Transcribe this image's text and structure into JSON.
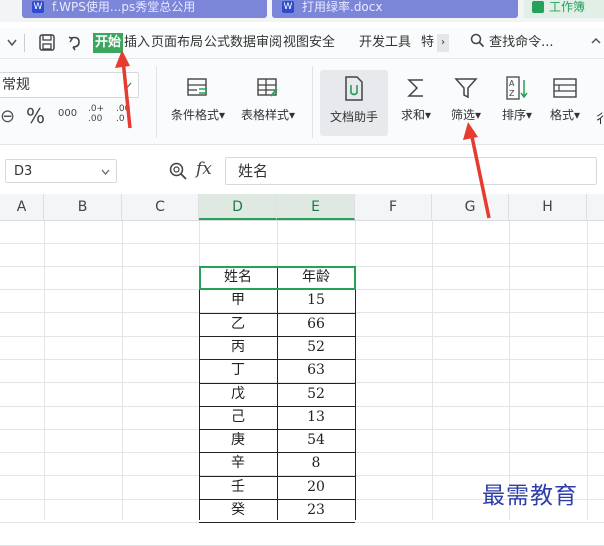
{
  "tabs": [
    {
      "label": "f.WPS使用...ps秀堂总公用"
    },
    {
      "label": "打用绿率.docx"
    },
    {
      "label": "工作簿"
    }
  ],
  "menubar": {
    "items": [
      "开始",
      "插入",
      "页面布局",
      "公式",
      "数据",
      "审阅",
      "视图",
      "安全",
      "开发工具",
      "特"
    ],
    "search": "查找命令..."
  },
  "ribbon": {
    "number_format": "常规",
    "percent": "%",
    "thousands": "000",
    "inc_decimal": ".0+ .00",
    "dec_decimal": ".00 .0",
    "buttons": [
      "条件格式",
      "表格样式",
      "文档助手",
      "求和",
      "筛选",
      "排序",
      "格式"
    ]
  },
  "formula_bar": {
    "cell_ref": "D3",
    "fx_label": "fx",
    "content": "姓名"
  },
  "columns": [
    "A",
    "B",
    "C",
    "D",
    "E",
    "F",
    "G",
    "H"
  ],
  "table": {
    "headers": [
      "姓名",
      "年龄"
    ],
    "rows": [
      [
        "甲",
        "15"
      ],
      [
        "乙",
        "66"
      ],
      [
        "丙",
        "52"
      ],
      [
        "丁",
        "63"
      ],
      [
        "戊",
        "52"
      ],
      [
        "己",
        "13"
      ],
      [
        "庚",
        "54"
      ],
      [
        "辛",
        "8"
      ],
      [
        "壬",
        "20"
      ],
      [
        "癸",
        "23"
      ]
    ]
  },
  "watermark": "最需教育",
  "colors": {
    "accent": "#25a15a",
    "arrow": "#e63b2e"
  }
}
